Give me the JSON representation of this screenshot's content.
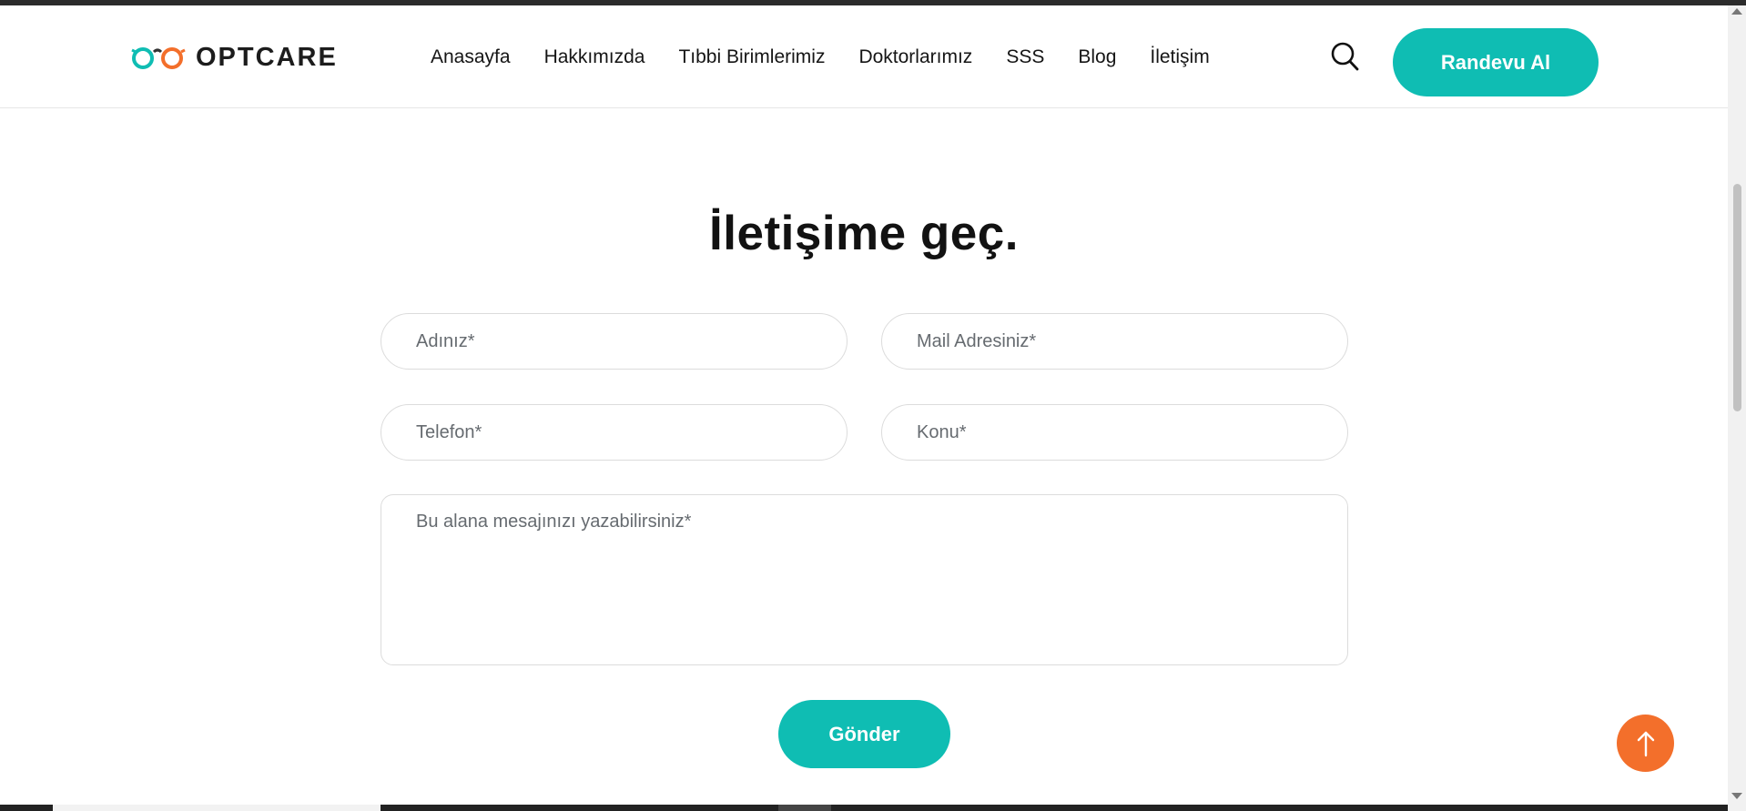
{
  "header": {
    "logo_text": "OPTCARE",
    "nav": [
      "Anasayfa",
      "Hakkımızda",
      "Tıbbi Birimlerimiz",
      "Doktorlarımız",
      "SSS",
      "Blog",
      "İletişim"
    ],
    "search_icon": "search-icon",
    "cta_label": "Randevu Al"
  },
  "main": {
    "title": "İletişime geç.",
    "form": {
      "name_placeholder": "Adınız*",
      "mail_placeholder": "Mail Adresiniz*",
      "phone_placeholder": "Telefon*",
      "subject_placeholder": "Konu*",
      "message_placeholder": "Bu alana mesajınızı yazabilirsiniz*",
      "submit_label": "Gönder"
    }
  },
  "scroll_top_icon": "arrow-up-icon",
  "colors": {
    "accent_teal": "#0fbdb3",
    "accent_orange": "#f36f2b",
    "text_dark": "#121212",
    "border": "#dcdcdc"
  }
}
